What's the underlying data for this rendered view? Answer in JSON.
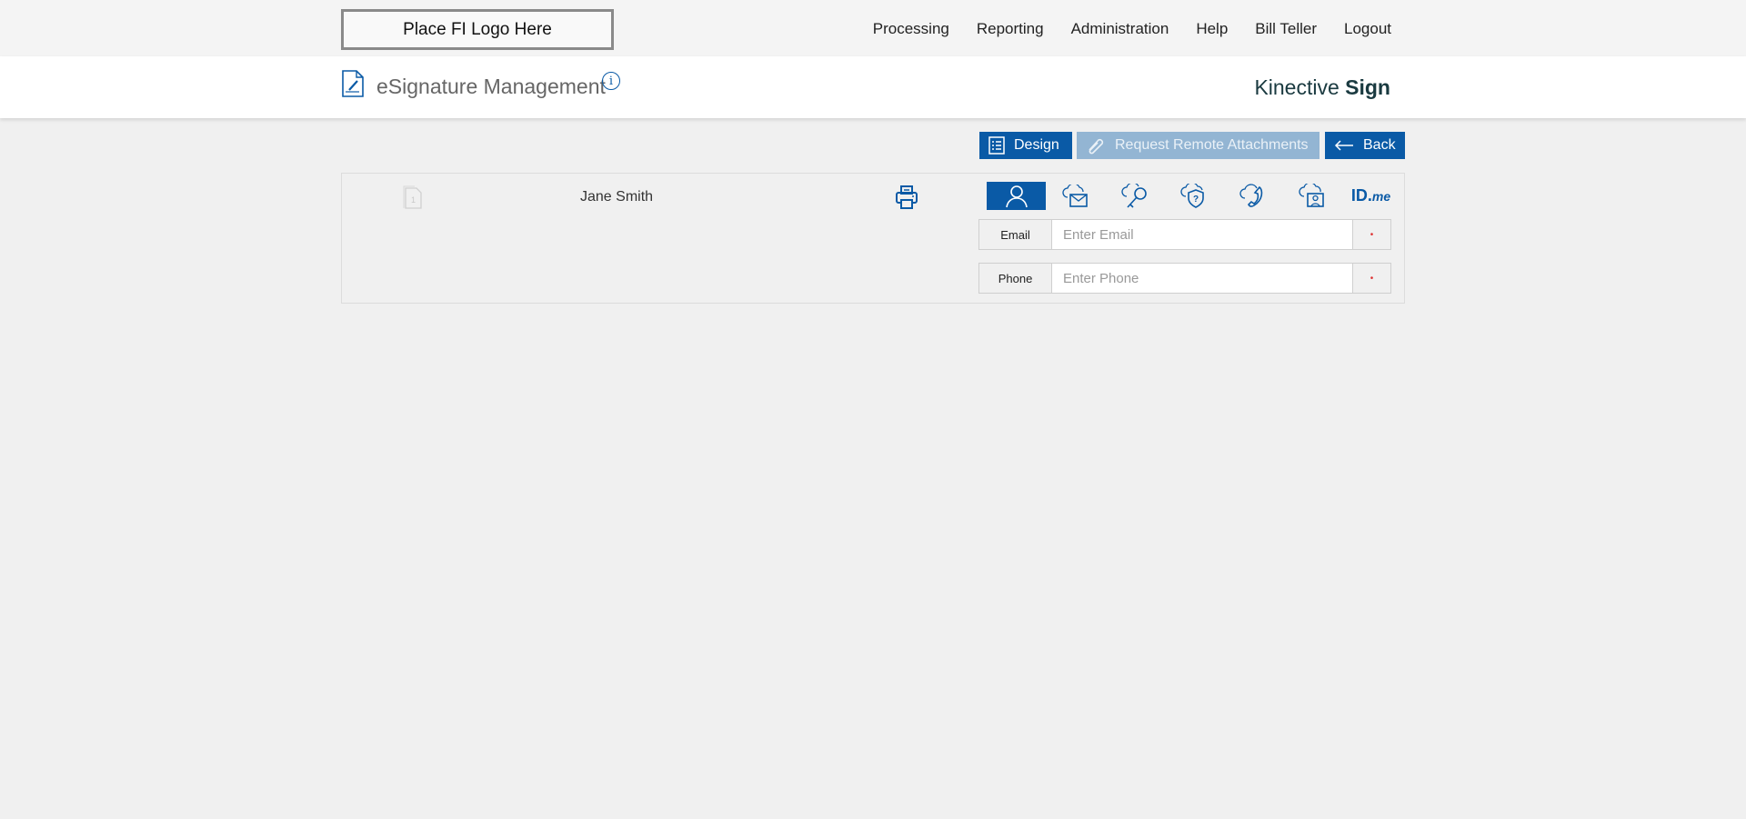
{
  "header": {
    "logo_text": "Place FI Logo Here",
    "nav": [
      "Processing",
      "Reporting",
      "Administration",
      "Help",
      "Bill Teller",
      "Logout"
    ]
  },
  "subheader": {
    "title": "eSignature Management",
    "brand_light": "Kinective",
    "brand_bold": "Sign"
  },
  "toolbar": {
    "design": "Design",
    "request_attachments": "Request Remote Attachments",
    "back": "Back"
  },
  "signer": {
    "name": "Jane Smith",
    "page_number": "1",
    "auth_tabs": [
      "user",
      "cloud-email",
      "cloud-key",
      "cloud-shield-question",
      "cloud-phone",
      "cloud-id-card",
      "ID.me"
    ],
    "idme_id": "ID.",
    "idme_me": "me",
    "email_label": "Email",
    "email_placeholder": "Enter Email",
    "email_value": "",
    "phone_label": "Phone",
    "phone_placeholder": "Enter Phone",
    "phone_value": "",
    "required_marker": "•"
  },
  "colors": {
    "accent": "#0a5aa6",
    "disabled": "#93b5d3"
  }
}
